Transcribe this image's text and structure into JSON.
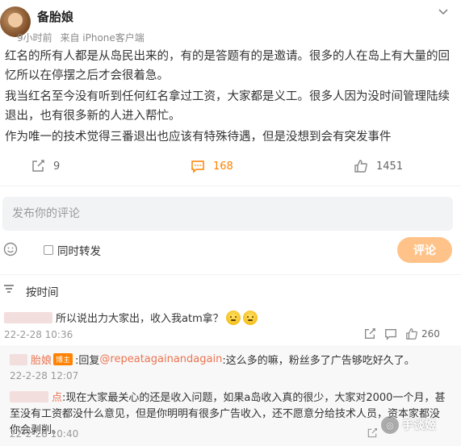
{
  "post": {
    "username": "备胎娘",
    "time": "9小时前",
    "source": "来自 iPhone客户端",
    "paragraphs": [
      "红名的所有人都是从岛民出来的，有的是答题有的是邀请。很多的人在岛上有大量的回忆所以在停摆之后才会很着急。",
      "我当红名至今没有听到任何红名拿过工资，大家都是义工。很多人因为没时间管理陆续退出，也有很多新的人进入帮忙。",
      "作为唯一的技术觉得三番退出也应该有特殊待遇，但是没想到会有突发事件"
    ],
    "repost_count": "9",
    "comment_count": "168",
    "like_count": "1451"
  },
  "composer": {
    "placeholder": "发布你的评论",
    "repost_label": "同时转发",
    "submit_label": "评论"
  },
  "sort_label": "按时间",
  "comments": [
    {
      "text": "所以说出力大家出，收入我atm拿？",
      "time": "22-2-28 10:36",
      "like_count": "260"
    }
  ],
  "replies": [
    {
      "author_tail": "胎娘",
      "badge": "博主",
      "reply_prefix": ":回复",
      "mention": "@repeatagainandagain",
      "text": ":这么多的嘛，粉丝多了广告够吃好久了。",
      "time": "22-2-28 12:07"
    },
    {
      "author_tail": "点",
      "text": ":现在大家最关心的还是收入问题，如果a岛收入真的很少，大家对2000一个月，甚至没有工资都没什么意见，但是你明明有很多广告收入，还不愿意分给技术人员，资本家都没你会剥削。",
      "time": "22-2-28 10:40"
    }
  ],
  "watermark": "手谈姬",
  "colors": {
    "accent": "#ff8200",
    "submit_bg": "#ffc389",
    "mention": "#eb7350"
  }
}
